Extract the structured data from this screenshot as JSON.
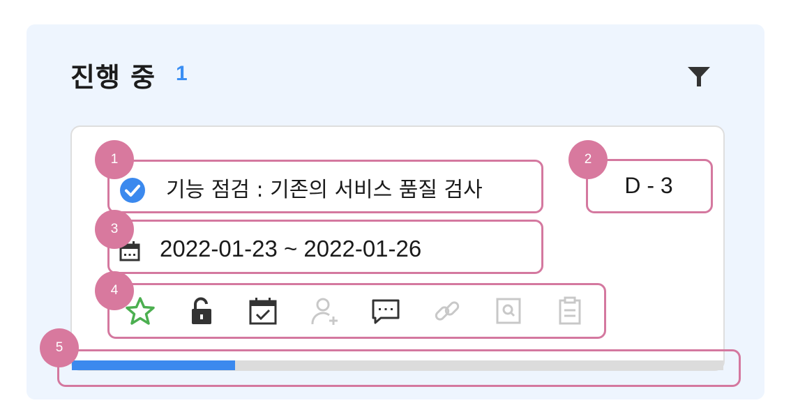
{
  "header": {
    "title": "진행 중",
    "count": "1"
  },
  "task": {
    "title": "기능 점검 : 기존의 서비스 품질 검사",
    "d_day": "D - 3",
    "date_range": "2022-01-23 ~ 2022-01-26",
    "progress_percent": 25
  },
  "actions": [
    "star-icon",
    "unlock-icon",
    "calendar-check-icon",
    "add-user-icon",
    "comment-icon",
    "link-icon",
    "search-document-icon",
    "clipboard-icon"
  ],
  "annotations": [
    "1",
    "2",
    "3",
    "4",
    "5"
  ],
  "colors": {
    "panel_bg": "#eef5fe",
    "accent_blue": "#3b89ee",
    "highlight_pink": "#d4789f",
    "star_green": "#4caf50",
    "disabled_gray": "#c8c8c8"
  }
}
